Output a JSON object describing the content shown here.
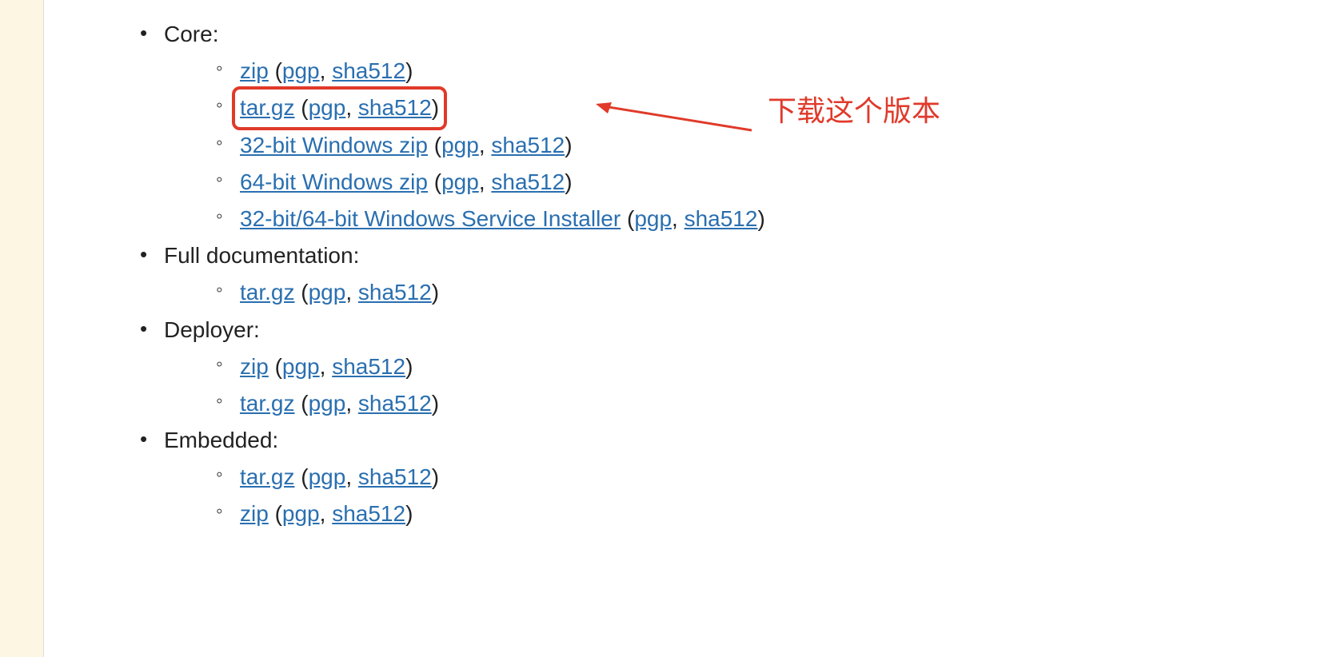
{
  "annotation": "下载这个版本",
  "sections": {
    "core": {
      "label": "Core:",
      "items": [
        {
          "main": "zip",
          "sig1": "pgp",
          "sig2": "sha512"
        },
        {
          "main": "tar.gz",
          "sig1": "pgp",
          "sig2": "sha512",
          "highlighted": true
        },
        {
          "main": "32-bit Windows zip",
          "sig1": "pgp",
          "sig2": "sha512"
        },
        {
          "main": "64-bit Windows zip",
          "sig1": "pgp",
          "sig2": "sha512"
        },
        {
          "main": "32-bit/64-bit Windows Service Installer",
          "sig1": "pgp",
          "sig2": "sha512"
        }
      ]
    },
    "fulldoc": {
      "label": "Full documentation:",
      "items": [
        {
          "main": "tar.gz",
          "sig1": "pgp",
          "sig2": "sha512"
        }
      ]
    },
    "deployer": {
      "label": "Deployer:",
      "items": [
        {
          "main": "zip",
          "sig1": "pgp",
          "sig2": "sha512"
        },
        {
          "main": "tar.gz",
          "sig1": "pgp",
          "sig2": "sha512"
        }
      ]
    },
    "embedded": {
      "label": "Embedded:",
      "items": [
        {
          "main": "tar.gz",
          "sig1": "pgp",
          "sig2": "sha512"
        },
        {
          "main": "zip",
          "sig1": "pgp",
          "sig2": "sha512"
        }
      ]
    }
  }
}
